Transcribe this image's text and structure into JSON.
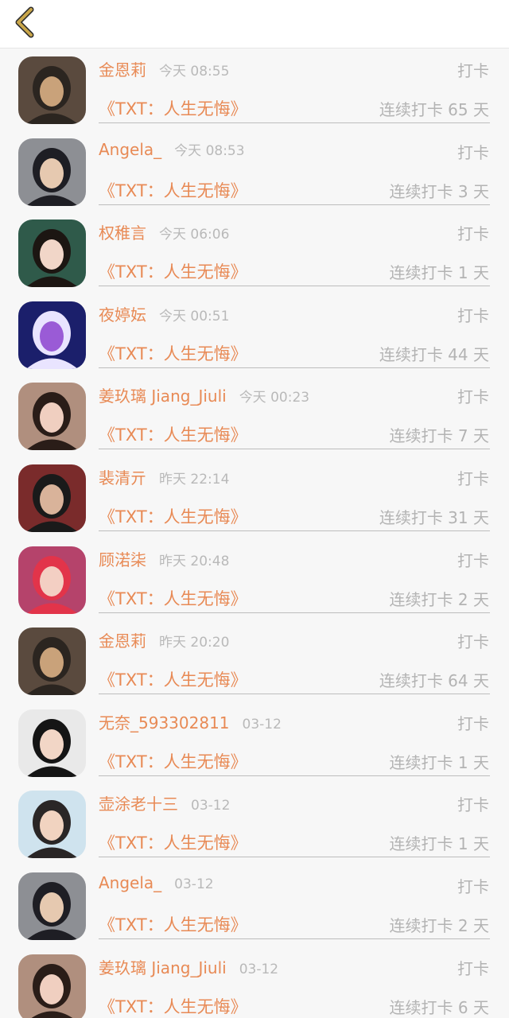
{
  "colors": {
    "accent": "#e88a55",
    "back_icon": "#c9a64a",
    "muted": "#b3b3b3",
    "background": "#f7f7f7"
  },
  "header": {
    "back_icon": "chevron-left-icon"
  },
  "entries": [
    {
      "name": "金恩莉",
      "time": "今天 08:55",
      "type": "打卡",
      "title": "《TXT：人生无悔》",
      "streak": "连续打卡 65 天",
      "avatar_colors": [
        "#5a4a3e",
        "#c9a27a",
        "#2b2520"
      ]
    },
    {
      "name": "Angela_",
      "time": "今天 08:53",
      "type": "打卡",
      "title": "《TXT：人生无悔》",
      "streak": "连续打卡 3 天",
      "avatar_colors": [
        "#8d8f94",
        "#e6c9b0",
        "#1e1e24"
      ]
    },
    {
      "name": "权稚言",
      "time": "今天 06:06",
      "type": "打卡",
      "title": "《TXT：人生无悔》",
      "streak": "连续打卡 1 天",
      "avatar_colors": [
        "#2f5a4a",
        "#f1d6c8",
        "#1c1612"
      ]
    },
    {
      "name": "夜婷妘",
      "time": "今天 00:51",
      "type": "打卡",
      "title": "《TXT：人生无悔》",
      "streak": "连续打卡 44 天",
      "avatar_colors": [
        "#1b1f6b",
        "#9a5bd6",
        "#e9e4ff"
      ]
    },
    {
      "name": "姜玖璃 Jiang_Jiuli",
      "time": "今天 00:23",
      "type": "打卡",
      "title": "《TXT：人生无悔》",
      "streak": "连续打卡 7 天",
      "avatar_colors": [
        "#b08f7e",
        "#f0cfc0",
        "#2a1d18"
      ]
    },
    {
      "name": "裴清亓",
      "time": "昨天 22:14",
      "type": "打卡",
      "title": "《TXT：人生无悔》",
      "streak": "连续打卡 31 天",
      "avatar_colors": [
        "#7a2b2b",
        "#d9b39a",
        "#1a1a1a"
      ]
    },
    {
      "name": "顾渃柒",
      "time": "昨天 20:48",
      "type": "打卡",
      "title": "《TXT：人生无悔》",
      "streak": "连续打卡 2 天",
      "avatar_colors": [
        "#b5436b",
        "#f3cfc3",
        "#e2344a"
      ]
    },
    {
      "name": "金恩莉",
      "time": "昨天 20:20",
      "type": "打卡",
      "title": "《TXT：人生无悔》",
      "streak": "连续打卡 64 天",
      "avatar_colors": [
        "#5a4a3e",
        "#c9a27a",
        "#2b2520"
      ]
    },
    {
      "name": "无奈_593302811",
      "time": "03-12",
      "type": "打卡",
      "title": "《TXT：人生无悔》",
      "streak": "连续打卡 1 天",
      "avatar_colors": [
        "#e9e9e9",
        "#f2d6c6",
        "#151515"
      ]
    },
    {
      "name": "壶涂老十三",
      "time": "03-12",
      "type": "打卡",
      "title": "《TXT：人生无悔》",
      "streak": "连续打卡 1 天",
      "avatar_colors": [
        "#cfe3ee",
        "#f1d3c0",
        "#2a2626"
      ]
    },
    {
      "name": "Angela_",
      "time": "03-12",
      "type": "打卡",
      "title": "《TXT：人生无悔》",
      "streak": "连续打卡 2 天",
      "avatar_colors": [
        "#8d8f94",
        "#e6c9b0",
        "#1e1e24"
      ]
    },
    {
      "name": "姜玖璃 Jiang_Jiuli",
      "time": "03-12",
      "type": "打卡",
      "title": "《TXT：人生无悔》",
      "streak": "连续打卡 6 天",
      "avatar_colors": [
        "#b08f7e",
        "#f0cfc0",
        "#2a1d18"
      ]
    }
  ]
}
